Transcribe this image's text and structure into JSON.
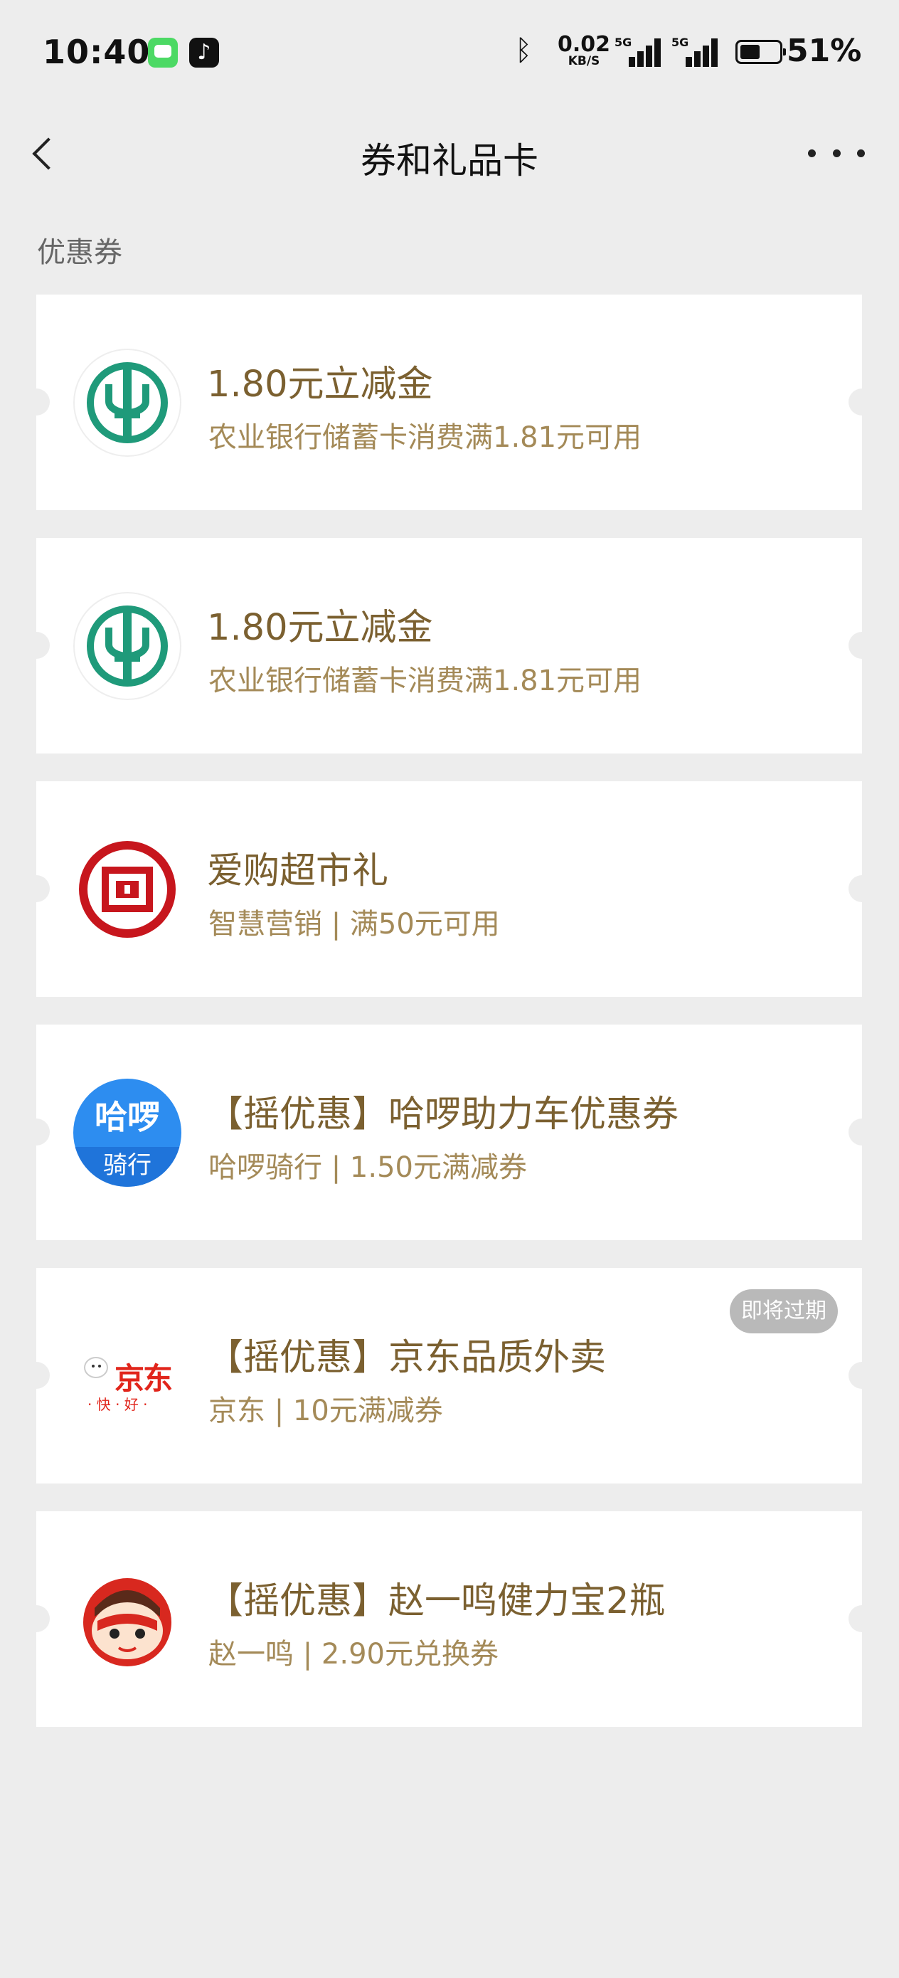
{
  "status_bar": {
    "time": "10:40",
    "net_speed_value": "0.02",
    "net_speed_unit": "KB/S",
    "signal_tag_1": "5G",
    "signal_tag_2": "5G",
    "battery_percent": "51%",
    "battery_level": 0.51,
    "icons": [
      "messages-app-icon",
      "tiktok-app-icon",
      "bluetooth-icon",
      "signal-icon",
      "battery-icon"
    ]
  },
  "nav": {
    "title": "券和礼品卡",
    "back_icon": "chevron-left-icon",
    "more_icon": "more-dots-icon"
  },
  "section": {
    "label": "优惠券"
  },
  "coupons": [
    {
      "name": "1.80元立减金",
      "desc": "农业银行储蓄卡消费满1.81元可用",
      "logo": "abc-bank-logo"
    },
    {
      "name": "1.80元立减金",
      "desc": "农业银行储蓄卡消费满1.81元可用",
      "logo": "abc-bank-logo"
    },
    {
      "name": "爱购超市礼",
      "desc": "智慧营销 | 满50元可用",
      "logo": "icbc-logo"
    },
    {
      "name": "【摇优惠】哈啰助力车优惠券",
      "desc": "哈啰骑行 | 1.50元满减券",
      "logo": "hello-bike-logo",
      "logo_text_1": "哈啰",
      "logo_text_2": "骑行"
    },
    {
      "name": "【摇优惠】京东品质外卖",
      "desc": "京东 | 10元满减券",
      "logo": "jd-logo",
      "logo_text_1": "京东",
      "logo_text_2": "· 快 · 好 ·",
      "badge": "即将过期"
    },
    {
      "name": "【摇优惠】赵一鸣健力宝2瓶",
      "desc": "赵一鸣 | 2.90元兑换券",
      "logo": "zhaoyiming-logo"
    }
  ],
  "colors": {
    "background": "#ededed",
    "card": "#ffffff",
    "title_gold": "#7b6030",
    "desc_gold": "#a48a58",
    "badge_gray": "#b9b9b9"
  }
}
